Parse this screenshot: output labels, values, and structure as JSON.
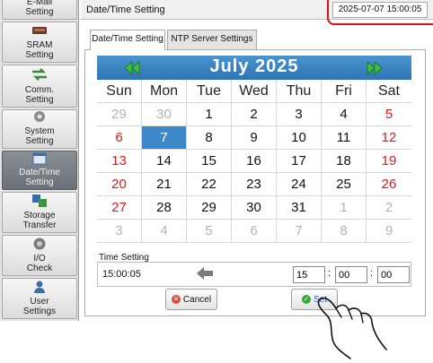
{
  "sidebar": {
    "items": [
      {
        "label": "E-Mail\nSetting",
        "icon": "email-icon"
      },
      {
        "label": "SRAM\nSetting",
        "icon": "sram-icon"
      },
      {
        "label": "Comm.\nSetting",
        "icon": "comm-icon"
      },
      {
        "label": "System\nSetting",
        "icon": "gear-icon"
      },
      {
        "label": "Date/Time\nSetting",
        "icon": "calendar-icon",
        "active": true
      },
      {
        "label": "Storage\nTransfer",
        "icon": "storage-transfer-icon"
      },
      {
        "label": "I/O\nCheck",
        "icon": "io-check-icon"
      },
      {
        "label": "User\nSettings",
        "icon": "user-icon"
      }
    ]
  },
  "header": {
    "title": "Date/Time Setting",
    "datetime": "2025-07-07  15:00:05"
  },
  "tabs": [
    {
      "label": "Date/Time Setting",
      "selected": true
    },
    {
      "label": "NTP Server Settings",
      "selected": false
    }
  ],
  "calendar": {
    "month_label": "July",
    "year_label": "2025",
    "prev_icon": "double-left-arrow-icon",
    "next_icon": "double-right-arrow-icon",
    "weekdays": [
      "Sun",
      "Mon",
      "Tue",
      "Wed",
      "Thu",
      "Fri",
      "Sat"
    ],
    "weeks": [
      [
        "29",
        "30",
        "1",
        "2",
        "3",
        "4",
        "5"
      ],
      [
        "6",
        "7",
        "8",
        "9",
        "10",
        "11",
        "12"
      ],
      [
        "13",
        "14",
        "15",
        "16",
        "17",
        "18",
        "19"
      ],
      [
        "20",
        "21",
        "22",
        "23",
        "24",
        "25",
        "26"
      ],
      [
        "27",
        "28",
        "29",
        "30",
        "31",
        "1",
        "2"
      ],
      [
        "3",
        "4",
        "5",
        "6",
        "7",
        "8",
        "9"
      ]
    ],
    "selected_day": "7",
    "colors": {
      "header": "#3a86c8",
      "selected": "#3c88c8",
      "weekend": "#e01a1a",
      "muted": "#b4b4b4"
    }
  },
  "time": {
    "label": "Time Setting",
    "current": "15:00:05",
    "hour": "15",
    "minute": "00",
    "second": "00",
    "separator": ":"
  },
  "buttons": {
    "cancel": "Cancel",
    "set": "Set"
  },
  "highlight_color": "#e01010"
}
